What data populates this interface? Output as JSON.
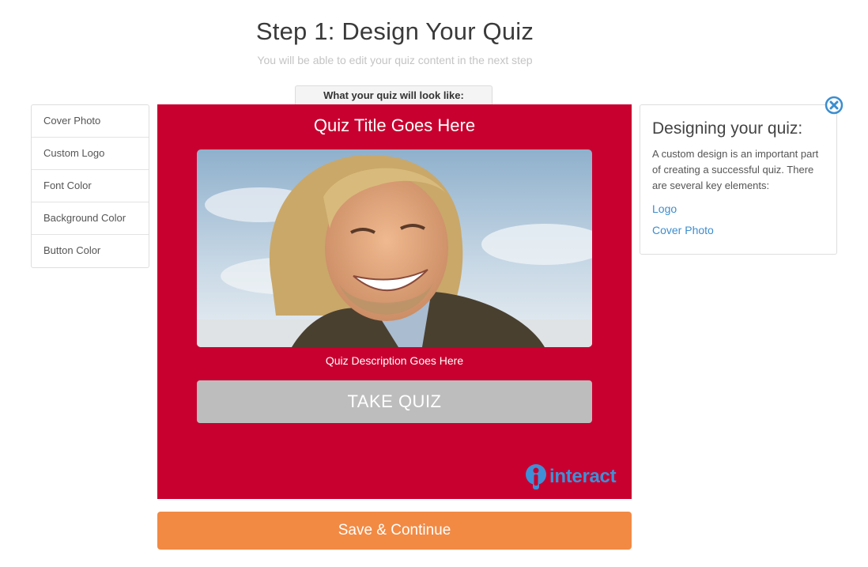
{
  "header": {
    "title": "Step 1: Design Your Quiz",
    "subtitle": "You will be able to edit your quiz content in the next step"
  },
  "preview_tab": {
    "label": "What your quiz will look like:"
  },
  "design_menu": {
    "items": [
      {
        "label": "Cover Photo"
      },
      {
        "label": "Custom Logo"
      },
      {
        "label": "Font Color"
      },
      {
        "label": "Background Color"
      },
      {
        "label": "Button Color"
      }
    ]
  },
  "quiz_preview": {
    "title": "Quiz Title Goes Here",
    "description": "Quiz Description Goes Here",
    "button_label": "TAKE QUIZ",
    "brand_logo_text": "interact",
    "background_color": "#c8002f",
    "button_color": "#bdbdbd",
    "cover_photo_icon": "portrait-photo"
  },
  "footer": {
    "save_label": "Save & Continue",
    "save_color": "#f28a44"
  },
  "help_panel": {
    "title": "Designing your quiz:",
    "text": "A custom design is an important part of creating a successful quiz. There are several key elements:",
    "links": [
      {
        "label": "Logo"
      },
      {
        "label": "Cover Photo"
      }
    ],
    "close_icon": "close-icon",
    "link_color": "#3c8dcf"
  }
}
